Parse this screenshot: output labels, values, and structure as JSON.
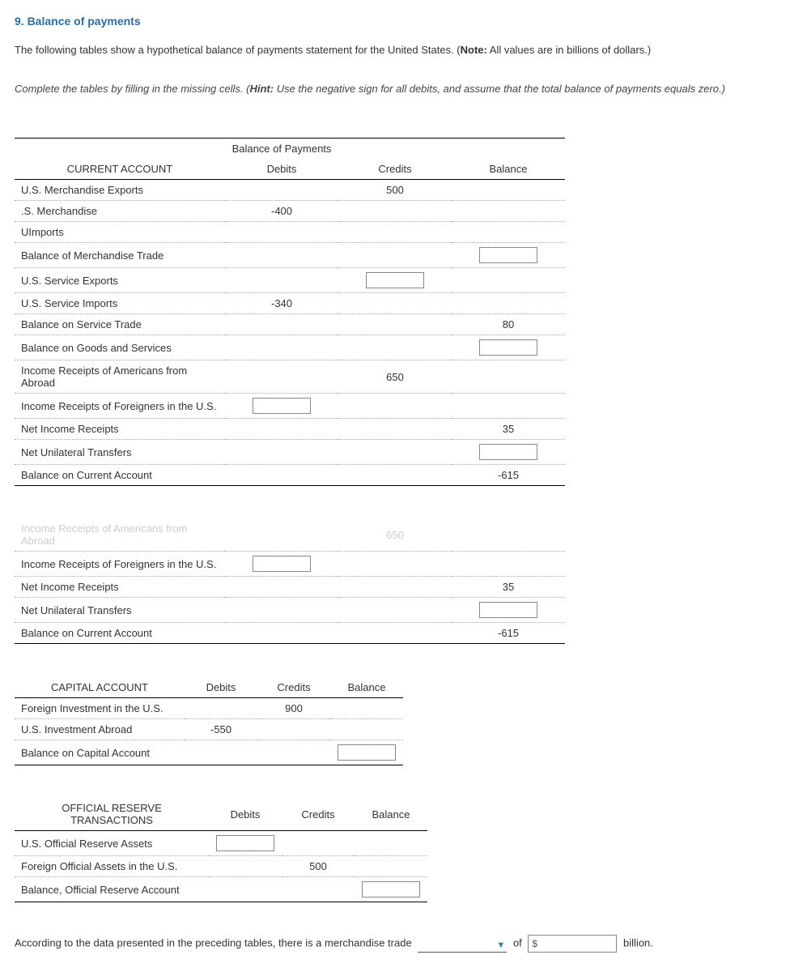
{
  "title": "9. Balance of payments",
  "intro_pre": "The following tables show a hypothetical balance of payments statement for the United States. (",
  "intro_note_b": "Note:",
  "intro_post": " All values are in billions of dollars.)",
  "instruction_pre": "Complete the tables by filling in the missing cells. (",
  "instruction_hint_b": "Hint:",
  "instruction_post": " Use the negative sign for all debits, and assume that the total balance of payments equals zero.)",
  "table1": {
    "title": "Balance of Payments",
    "headers": {
      "acct": "CURRENT ACCOUNT",
      "debits": "Debits",
      "credits": "Credits",
      "balance": "Balance"
    },
    "rows": {
      "r1": {
        "label": "U.S. Merchandise Exports",
        "credits": "500"
      },
      "r2": {
        "label": ".S. Merchandise",
        "debits": "-400"
      },
      "r3": {
        "label": "UImports"
      },
      "r4": {
        "label": "Balance of Merchandise Trade"
      },
      "r5": {
        "label": "U.S. Service Exports"
      },
      "r6": {
        "label": "U.S. Service Imports",
        "debits": "-340"
      },
      "r7": {
        "label": "Balance on Service Trade",
        "balance": "80"
      },
      "r8": {
        "label": "Balance on Goods and Services"
      },
      "r9": {
        "label": "Income Receipts of Americans from Abroad",
        "credits": "650"
      },
      "r10": {
        "label": "Income Receipts of Foreigners in the U.S."
      },
      "r11": {
        "label": "Net Income Receipts",
        "balance": "35"
      },
      "r12": {
        "label": "Net Unilateral Transfers"
      },
      "r13": {
        "label": "Balance on Current Account",
        "balance": "-615"
      }
    }
  },
  "table2": {
    "trunc_label": "Income Receipts of Americans from Abroad",
    "trunc_credits": "650",
    "rows": {
      "r1": {
        "label": "Income Receipts of Foreigners in the U.S."
      },
      "r2": {
        "label": "Net Income Receipts",
        "balance": "35"
      },
      "r3": {
        "label": "Net Unilateral Transfers"
      },
      "r4": {
        "label": "Balance on Current Account",
        "balance": "-615"
      }
    }
  },
  "table3": {
    "headers": {
      "acct": "CAPITAL ACCOUNT",
      "debits": "Debits",
      "credits": "Credits",
      "balance": "Balance"
    },
    "rows": {
      "r1": {
        "label": "Foreign Investment in the U.S.",
        "credits": "900"
      },
      "r2": {
        "label": "U.S. Investment Abroad",
        "debits": "-550"
      },
      "r3": {
        "label": "Balance on Capital Account"
      }
    }
  },
  "table4": {
    "headers": {
      "acct": "OFFICIAL RESERVE TRANSACTIONS",
      "debits": "Debits",
      "credits": "Credits",
      "balance": "Balance"
    },
    "rows": {
      "r1": {
        "label": "U.S. Official Reserve Assets"
      },
      "r2": {
        "label": "Foreign Official Assets in the U.S.",
        "credits": "500"
      },
      "r3": {
        "label": "Balance, Official Reserve Account"
      }
    }
  },
  "bottom": {
    "pre": "According to the data presented in the preceding tables, there is a merchandise trade ",
    "of": " of ",
    "dollar_prefix": "$",
    "suffix": " billion."
  }
}
